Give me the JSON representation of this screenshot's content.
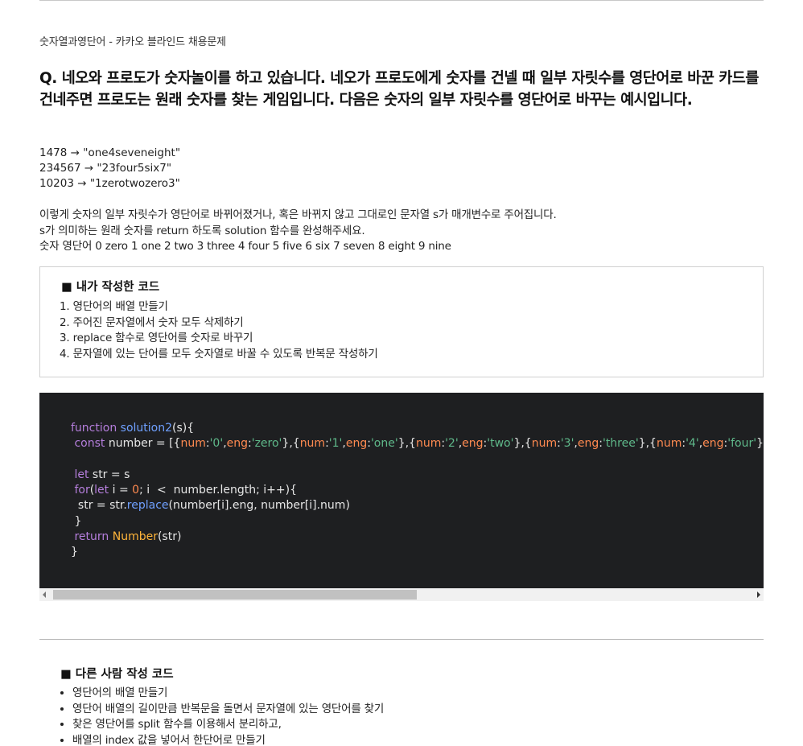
{
  "subtitle": "숫자열과영단어 - 카카오 블라인드 채용문제",
  "question": "Q. 네오와 프로도가 숫자놀이를 하고 있습니다. 네오가 프로도에게 숫자를 건넬 때 일부 자릿수를 영단어로 바꾼 카드를 건네주면 프로도는 원래 숫자를 찾는 게임입니다. 다음은 숫자의 일부 자릿수를 영단어로 바꾸는 예시입니다.",
  "examples": [
    "1478 → \"one4seveneight\"",
    "234567 → \"23four5six7\"",
    "10203 → \"1zerotwozero3\""
  ],
  "description": [
    "이렇게 숫자의 일부 자릿수가 영단어로 바뀌어졌거나, 혹은 바뀌지 않고 그대로인 문자열 s가 매개변수로 주어집니다.",
    "s가 의미하는 원래 숫자를 return 하도록 solution 함수를 완성해주세요.",
    "숫자 영단어 0 zero 1 one 2 two 3 three 4 four 5 five 6 six 7 seven 8 eight 9 nine"
  ],
  "my_code": {
    "heading": "■ 내가 작성한 코드",
    "steps": [
      "1. 영단어의 배열 만들기",
      "2. 주어진 문자열에서 숫자 모두 삭제하기",
      "3. replace 함수로 영단어를 숫자로 바꾸기",
      "4. 문자열에 있는 단어를 모두 숫자열로 바꿀 수 있도록 반복문 작성하기"
    ]
  },
  "code": {
    "l1": {
      "kw": "function",
      "fn": "solution2",
      "rest": "(s){"
    },
    "l2": {
      "kw": "const",
      "pre": " number = [{",
      "k1": "num",
      "v1": "'0'",
      "k2": "eng",
      "v2": "'zero'",
      "k3": "num",
      "v3": "'1'",
      "k4": "eng",
      "v4": "'one'",
      "k5": "num",
      "v5": "'2'",
      "k6": "eng",
      "v6": "'two'",
      "k7": "num",
      "v7": "'3'",
      "k8": "eng",
      "v8": "'three'",
      "k9": "num",
      "v9": "'4'",
      "k10": "eng",
      "v10": "'four'"
    },
    "l4": {
      "kw": "let",
      "rest": " str = s"
    },
    "l5": {
      "kw": "for",
      "kw2": "let",
      "mid": " i = ",
      "zero": "0",
      "rest": "; i  <  number.length; i++){"
    },
    "l6": {
      "pre": "str = str.",
      "fn": "replace",
      "rest": "(number[i].eng, number[i].num)"
    },
    "l7": {
      "text": "}"
    },
    "l8": {
      "kw": "return",
      "type": "Number",
      "rest": "(str)"
    },
    "l9": {
      "text": "}"
    }
  },
  "other_code": {
    "heading": "■ 다른 사람 작성 코드",
    "items": [
      "영단어의 배열 만들기",
      "영단어 배열의 길이만큼 반복문을 돌면서 문자열에 있는 영단어를 찾기",
      "찾은 영단어를 split 함수를 이용해서 분리하고,",
      "배열의 index 값을 넣어서 한단어로 만들기"
    ]
  },
  "colors": {
    "code_bg": "#1e1f21",
    "keyword": "#b57edc",
    "function": "#6fa0ff",
    "string": "#5fb98a",
    "number": "#ff8a50",
    "type": "#ffb43a"
  }
}
